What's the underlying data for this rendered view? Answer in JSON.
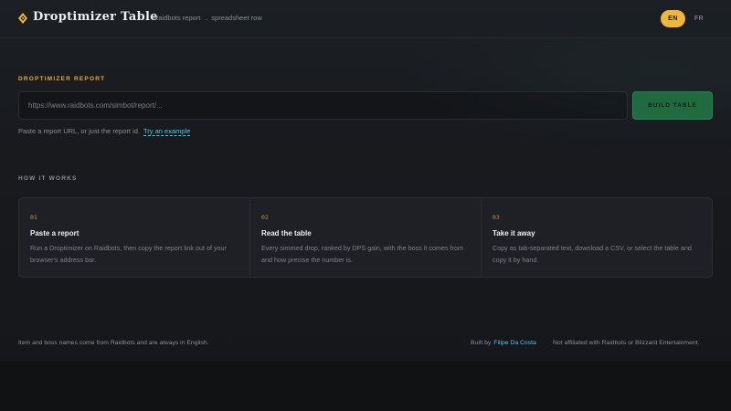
{
  "header": {
    "brand_icon": "diamond-icon",
    "title": "Droptimizer Table",
    "tagline_from": "Raidbots report",
    "tagline_arrow": "→",
    "tagline_to": "spreadsheet row",
    "languages": [
      {
        "label": "EN",
        "active": true
      },
      {
        "label": "FR",
        "active": false
      }
    ]
  },
  "report": {
    "section_label": "DROPTIMIZER REPORT",
    "input_placeholder": "https://www.raidbots.com/simbot/report/...",
    "input_value": "",
    "build_label": "BUILD TABLE",
    "hint_text": "Paste a report URL, or just the report id.",
    "example_link": "Try an example"
  },
  "how": {
    "section_label": "HOW IT WORKS",
    "steps": [
      {
        "num": "01",
        "title": "Paste a report",
        "desc": "Run a Droptimizer on Raidbots, then copy the report link out of your browser's address bar."
      },
      {
        "num": "02",
        "title": "Read the table",
        "desc": "Every simmed drop, ranked by DPS gain, with the boss it comes from and how precise the number is."
      },
      {
        "num": "03",
        "title": "Take it away",
        "desc": "Copy as tab-separated text, download a CSV, or select the table and copy it by hand."
      }
    ]
  },
  "footer": {
    "note": "Item and boss names come from Raidbots and are always in English.",
    "built_by": "Built by",
    "author": "Filipe Da Costa",
    "disclaimer": "Not affiliated with Raidbots or Blizzard Entertainment."
  },
  "colors": {
    "accent": "#f0b63c",
    "link": "#4cc9e8",
    "button": "#1f6e40",
    "background": "#1a1c20"
  }
}
